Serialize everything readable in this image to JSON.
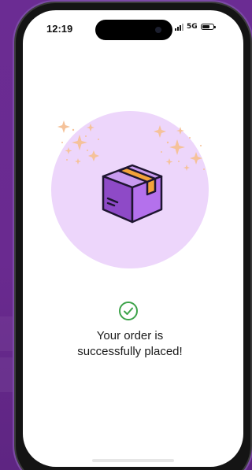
{
  "status_bar": {
    "time": "12:19",
    "network": "5G",
    "icons": [
      "signal-icon",
      "battery-icon"
    ]
  },
  "illustration": {
    "icons": [
      "package-box-icon",
      "sparkles-icon"
    ],
    "colors": {
      "circle": "#EDD6FB",
      "box": "#9A4FD0",
      "tape": "#F2A23A",
      "sparkles": "#F5C29A"
    }
  },
  "confirmation": {
    "icon": "check-circle-icon",
    "icon_color": "#3DA34A",
    "message_line1": "Your order is",
    "message_line2": "successfully placed!"
  },
  "theme": {
    "background": "#6B2C93"
  }
}
